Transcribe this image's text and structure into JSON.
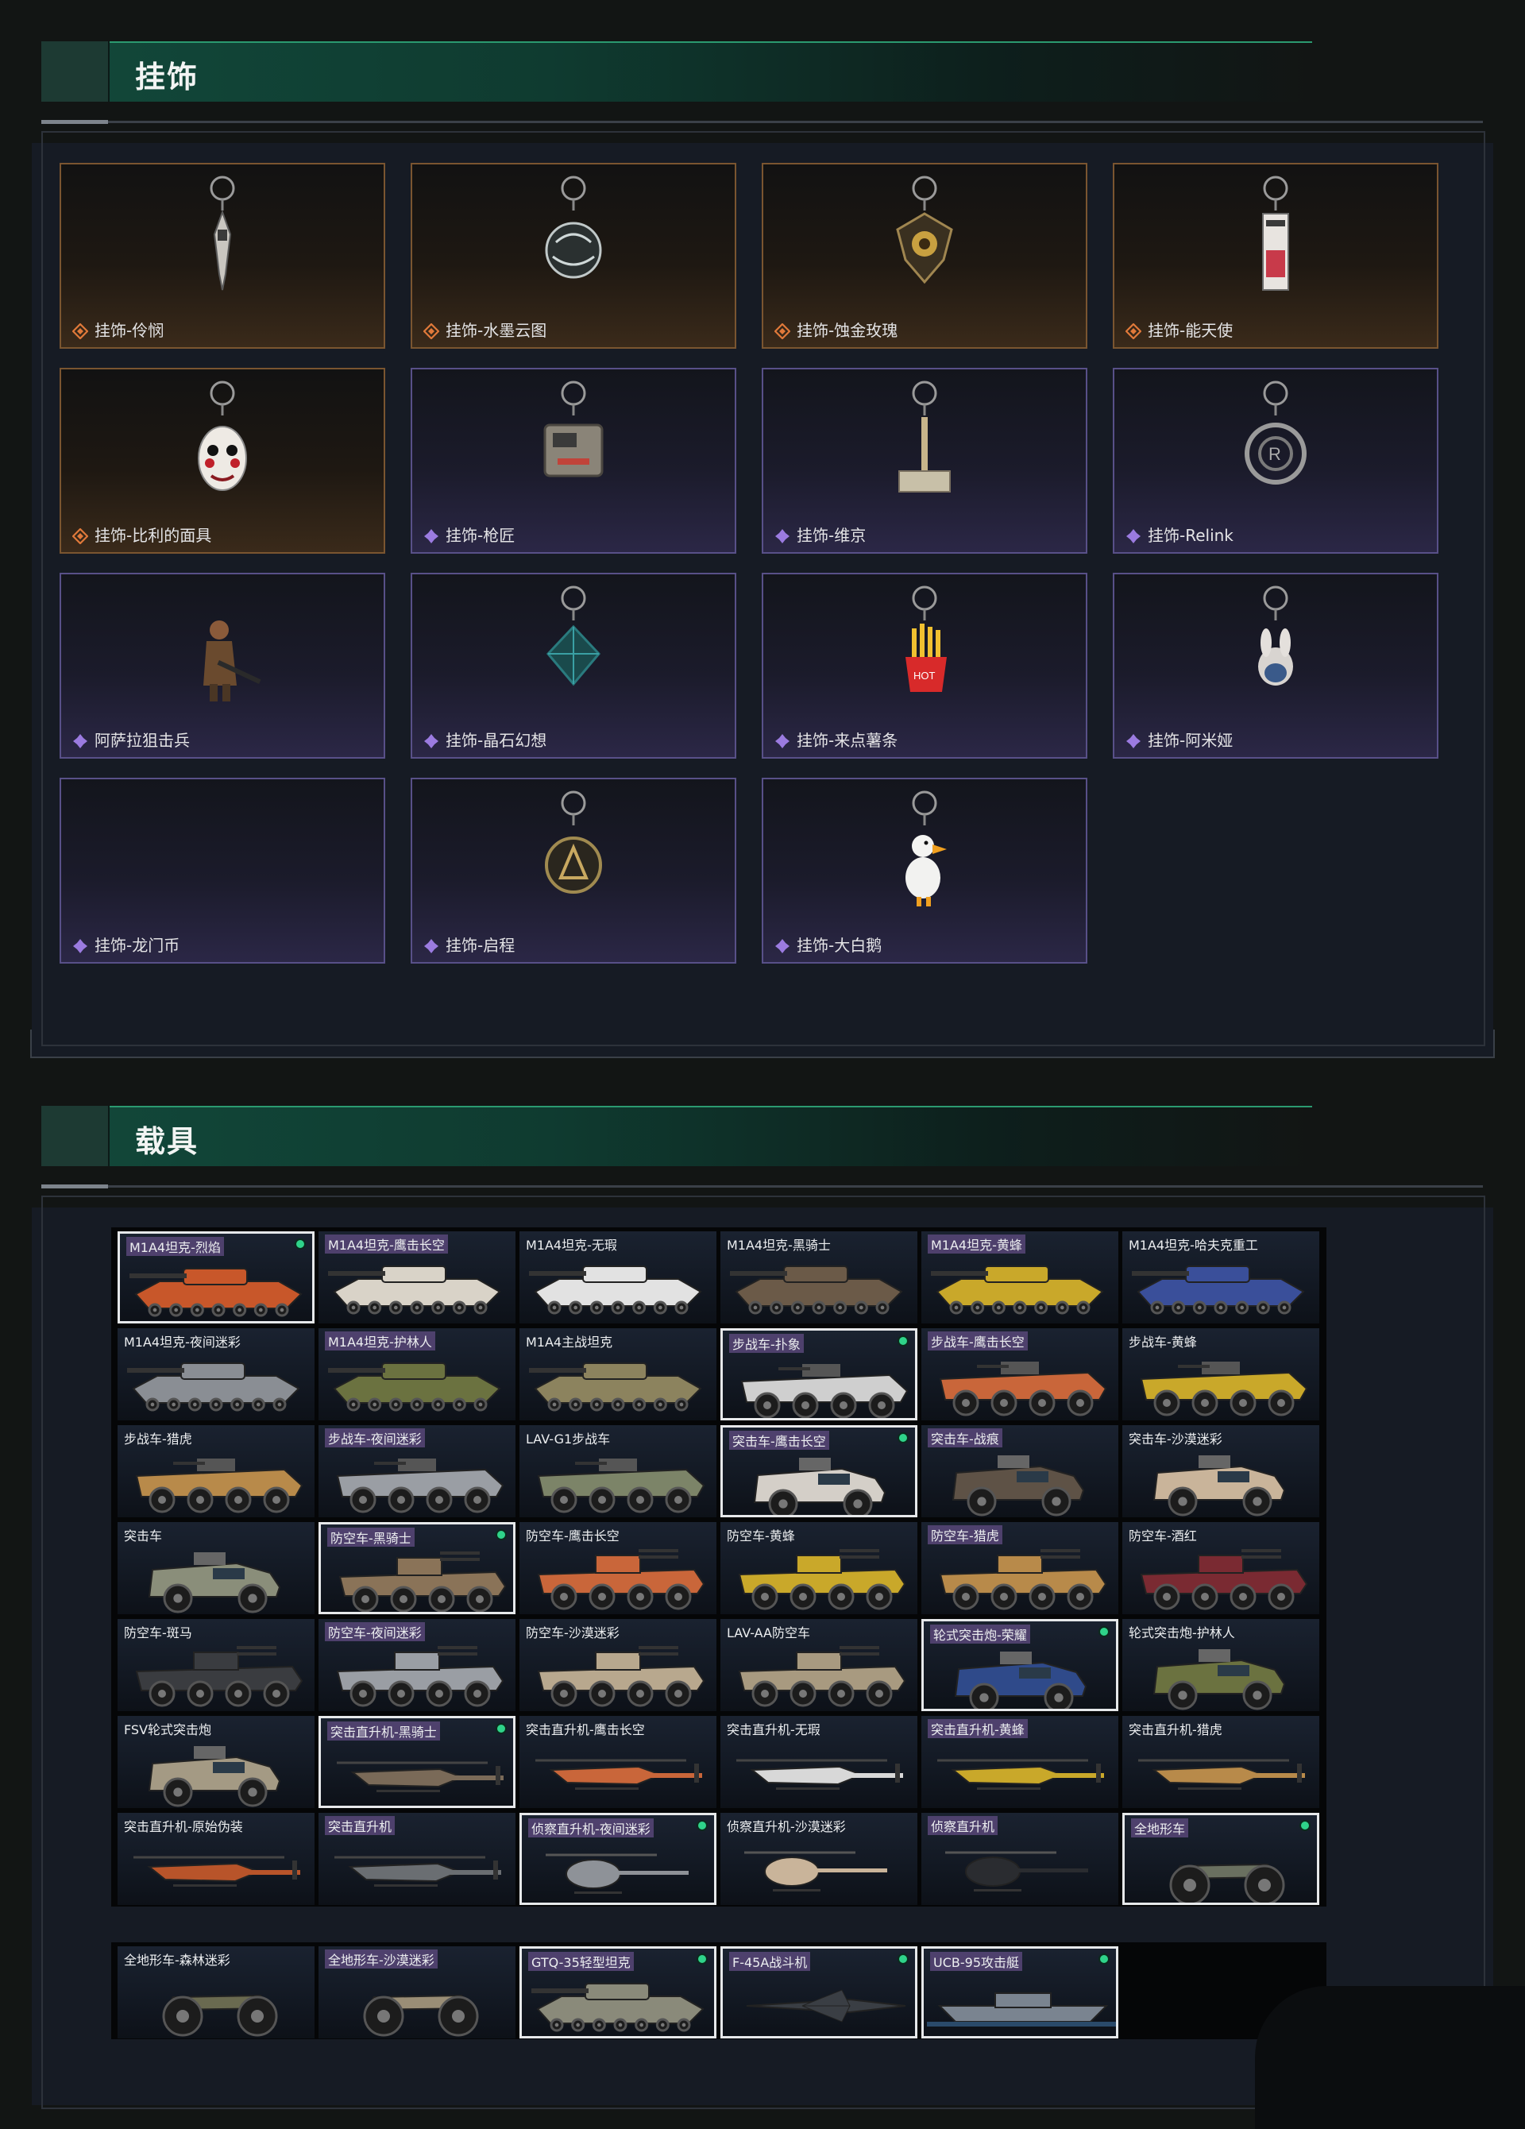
{
  "sections": {
    "charms": {
      "title": "挂饰"
    },
    "vehicles": {
      "title": "载具"
    }
  },
  "colors": {
    "gold_rarity": "#e0793a",
    "purple_rarity": "#9b7be0",
    "owned_dot": "#2fd38a",
    "header_green": "#12483a"
  },
  "charms": [
    {
      "label": "挂饰-伶悯",
      "rarity": "gold",
      "icon": "kunai-charm-icon"
    },
    {
      "label": "挂饰-水墨云图",
      "rarity": "gold",
      "icon": "orb-charm-icon"
    },
    {
      "label": "挂饰-蚀金玫瑰",
      "rarity": "gold",
      "icon": "rose-badge-charm-icon"
    },
    {
      "label": "挂饰-能天使",
      "rarity": "gold",
      "icon": "tag-charm-icon"
    },
    {
      "label": "挂饰-比利的面具",
      "rarity": "gold",
      "icon": "mask-charm-icon"
    },
    {
      "label": "挂饰-枪匠",
      "rarity": "purple",
      "icon": "toolbox-charm-icon"
    },
    {
      "label": "挂饰-维京",
      "rarity": "purple",
      "icon": "hammer-charm-icon"
    },
    {
      "label": "挂饰-Relink",
      "rarity": "purple",
      "icon": "relink-charm-icon"
    },
    {
      "label": "阿萨拉狙击兵",
      "rarity": "purple",
      "icon": "soldier-charm-icon"
    },
    {
      "label": "挂饰-晶石幻想",
      "rarity": "purple",
      "icon": "crystal-charm-icon"
    },
    {
      "label": "挂饰-来点薯条",
      "rarity": "purple",
      "icon": "fries-charm-icon"
    },
    {
      "label": "挂饰-阿米娅",
      "rarity": "purple",
      "icon": "bunny-charm-icon"
    },
    {
      "label": "挂饰-龙门币",
      "rarity": "purple",
      "icon": "none"
    },
    {
      "label": "挂饰-启程",
      "rarity": "purple",
      "icon": "coin-charm-icon"
    },
    {
      "label": "挂饰-大白鹅",
      "rarity": "purple",
      "icon": "goose-charm-icon"
    }
  ],
  "vehicles": [
    {
      "label": "M1A4坦克-烈焰",
      "type": "tank",
      "color": "#c8572a",
      "selected": true,
      "owned": true
    },
    {
      "label": "M1A4坦克-鹰击长空",
      "type": "tank",
      "color": "#d9d3c8",
      "selected": false,
      "owned": false
    },
    {
      "label": "M1A4坦克-无瑕",
      "type": "tank",
      "color": "#e2e2e2",
      "selected": false,
      "owned": false
    },
    {
      "label": "M1A4坦克-黑骑士",
      "type": "tank",
      "color": "#6b5a48",
      "selected": false,
      "owned": false
    },
    {
      "label": "M1A4坦克-黄蜂",
      "type": "tank",
      "color": "#c9a82a",
      "selected": false,
      "owned": false
    },
    {
      "label": "M1A4坦克-哈夫克重工",
      "type": "tank",
      "color": "#3a4f9a",
      "selected": false,
      "owned": false
    },
    {
      "label": "M1A4坦克-夜间迷彩",
      "type": "tank",
      "color": "#8a8e94",
      "selected": false,
      "owned": false
    },
    {
      "label": "M1A4坦克-护林人",
      "type": "tank",
      "color": "#6b7240",
      "selected": false,
      "owned": false
    },
    {
      "label": "M1A4主战坦克",
      "type": "tank",
      "color": "#8c835e",
      "selected": false,
      "owned": false
    },
    {
      "label": "步战车-扑象",
      "type": "ifv",
      "color": "#cfcfcf",
      "selected": true,
      "owned": true
    },
    {
      "label": "步战车-鹰击长空",
      "type": "ifv",
      "color": "#c9663a",
      "selected": false,
      "owned": false
    },
    {
      "label": "步战车-黄蜂",
      "type": "ifv",
      "color": "#c9a82a",
      "selected": false,
      "owned": false
    },
    {
      "label": "步战车-猎虎",
      "type": "ifv",
      "color": "#b88a4a",
      "selected": false,
      "owned": false
    },
    {
      "label": "步战车-夜间迷彩",
      "type": "ifv",
      "color": "#9a9ea4",
      "selected": false,
      "owned": false
    },
    {
      "label": "LAV-G1步战车",
      "type": "ifv",
      "color": "#7c8468",
      "selected": false,
      "owned": false
    },
    {
      "label": "突击车-鹰击长空",
      "type": "truck",
      "color": "#d4cfc8",
      "selected": true,
      "owned": true
    },
    {
      "label": "突击车-战痕",
      "type": "truck",
      "color": "#5e5246",
      "selected": false,
      "owned": false
    },
    {
      "label": "突击车-沙漠迷彩",
      "type": "truck",
      "color": "#c9b49a",
      "selected": false,
      "owned": false
    },
    {
      "label": "突击车",
      "type": "truck",
      "color": "#8a8e7a",
      "selected": false,
      "owned": false
    },
    {
      "label": "防空车-黑骑士",
      "type": "aa",
      "color": "#8a7358",
      "selected": true,
      "owned": true
    },
    {
      "label": "防空车-鹰击长空",
      "type": "aa",
      "color": "#c9663a",
      "selected": false,
      "owned": false
    },
    {
      "label": "防空车-黄蜂",
      "type": "aa",
      "color": "#c9a82a",
      "selected": false,
      "owned": false
    },
    {
      "label": "防空车-猎虎",
      "type": "aa",
      "color": "#b88a4a",
      "selected": false,
      "owned": false
    },
    {
      "label": "防空车-酒红",
      "type": "aa",
      "color": "#7a2a32",
      "selected": false,
      "owned": false
    },
    {
      "label": "防空车-斑马",
      "type": "aa",
      "color": "#3a3c40",
      "selected": false,
      "owned": false
    },
    {
      "label": "防空车-夜间迷彩",
      "type": "aa",
      "color": "#9a9ea4",
      "selected": false,
      "owned": false
    },
    {
      "label": "防空车-沙漠迷彩",
      "type": "aa",
      "color": "#b8a88e",
      "selected": false,
      "owned": false
    },
    {
      "label": "LAV-AA防空车",
      "type": "aa",
      "color": "#a89a80",
      "selected": false,
      "owned": false
    },
    {
      "label": "轮式突击炮-荣耀",
      "type": "truck",
      "color": "#2f4a8a",
      "selected": true,
      "owned": true
    },
    {
      "label": "轮式突击炮-护林人",
      "type": "truck",
      "color": "#6b7240",
      "selected": false,
      "owned": false
    },
    {
      "label": "FSV轮式突击炮",
      "type": "truck",
      "color": "#a49a84",
      "selected": false,
      "owned": false
    },
    {
      "label": "突击直升机-黑骑士",
      "type": "heli",
      "color": "#7a6a58",
      "selected": true,
      "owned": true
    },
    {
      "label": "突击直升机-鹰击长空",
      "type": "heli",
      "color": "#c9663a",
      "selected": false,
      "owned": false
    },
    {
      "label": "突击直升机-无瑕",
      "type": "heli",
      "color": "#d8d8d8",
      "selected": false,
      "owned": false
    },
    {
      "label": "突击直升机-黄蜂",
      "type": "heli",
      "color": "#c9a82a",
      "selected": false,
      "owned": false
    },
    {
      "label": "突击直升机-猎虎",
      "type": "heli",
      "color": "#b88a4a",
      "selected": false,
      "owned": false
    },
    {
      "label": "突击直升机-原始伪装",
      "type": "heli",
      "color": "#b8542a",
      "selected": false,
      "owned": false
    },
    {
      "label": "突击直升机",
      "type": "heli",
      "color": "#6a6e72",
      "selected": false,
      "owned": false
    },
    {
      "label": "侦察直升机-夜间迷彩",
      "type": "scout",
      "color": "#8e9298",
      "selected": true,
      "owned": true
    },
    {
      "label": "侦察直升机-沙漠迷彩",
      "type": "scout",
      "color": "#c9b49a",
      "selected": false,
      "owned": false
    },
    {
      "label": "侦察直升机",
      "type": "scout",
      "color": "#2a2c30",
      "selected": false,
      "owned": false
    },
    {
      "label": "全地形车",
      "type": "atv",
      "color": "#6a7060",
      "selected": true,
      "owned": true
    },
    {
      "label": "全地形车-森林迷彩",
      "type": "atv",
      "color": "#6a6a50",
      "selected": false,
      "owned": false
    },
    {
      "label": "全地形车-沙漠迷彩",
      "type": "atv",
      "color": "#9a8e76",
      "selected": false,
      "owned": false
    },
    {
      "label": "GTQ-35轻型坦克",
      "type": "tank",
      "color": "#8a8a7a",
      "selected": true,
      "owned": true
    },
    {
      "label": "F-45A战斗机",
      "type": "jet",
      "color": "#3a3e44",
      "selected": true,
      "owned": true
    },
    {
      "label": "UCB-95攻击艇",
      "type": "boat",
      "color": "#7a8490",
      "selected": true,
      "owned": true
    }
  ]
}
